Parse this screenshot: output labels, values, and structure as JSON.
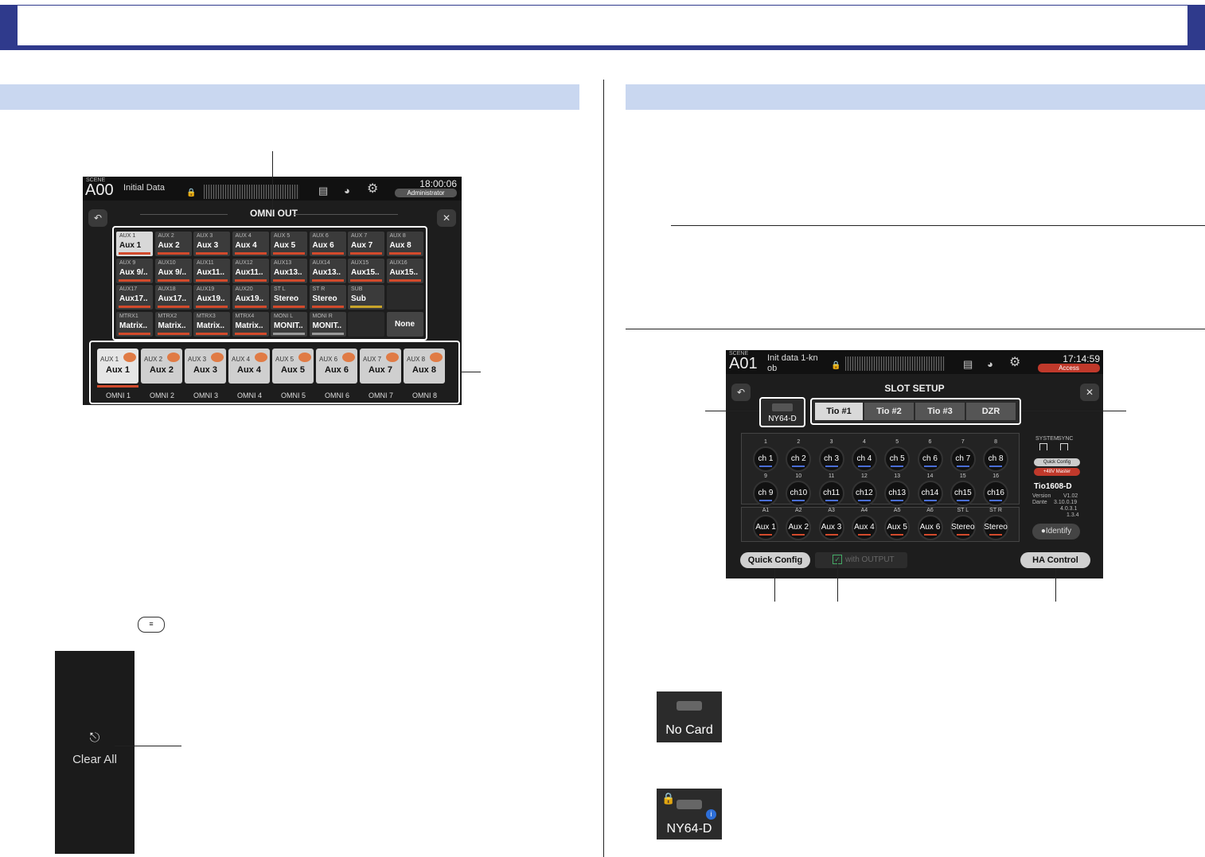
{
  "omni_screen": {
    "scene_label": "SCENE",
    "scene_number": "A00",
    "scene_name": "Initial Data",
    "time": "18:00:06",
    "user": "Administrator",
    "title": "OMNI OUT",
    "grid": [
      {
        "t": "AUX 1",
        "n": "Aux 1"
      },
      {
        "t": "AUX 2",
        "n": "Aux 2"
      },
      {
        "t": "AUX 3",
        "n": "Aux 3"
      },
      {
        "t": "AUX 4",
        "n": "Aux 4"
      },
      {
        "t": "AUX 5",
        "n": "Aux 5"
      },
      {
        "t": "AUX 6",
        "n": "Aux 6"
      },
      {
        "t": "AUX 7",
        "n": "Aux 7"
      },
      {
        "t": "AUX 8",
        "n": "Aux 8"
      },
      {
        "t": "AUX 9",
        "n": "Aux 9/.."
      },
      {
        "t": "AUX10",
        "n": "Aux 9/.."
      },
      {
        "t": "AUX11",
        "n": "Aux11.."
      },
      {
        "t": "AUX12",
        "n": "Aux11.."
      },
      {
        "t": "AUX13",
        "n": "Aux13.."
      },
      {
        "t": "AUX14",
        "n": "Aux13.."
      },
      {
        "t": "AUX15",
        "n": "Aux15.."
      },
      {
        "t": "AUX16",
        "n": "Aux15.."
      },
      {
        "t": "AUX17",
        "n": "Aux17.."
      },
      {
        "t": "AUX18",
        "n": "Aux17.."
      },
      {
        "t": "AUX19",
        "n": "Aux19.."
      },
      {
        "t": "AUX20",
        "n": "Aux19.."
      },
      {
        "t": "ST L",
        "n": "Stereo"
      },
      {
        "t": "ST R",
        "n": "Stereo"
      },
      {
        "t": "SUB",
        "n": "Sub"
      },
      {
        "t": "",
        "n": ""
      },
      {
        "t": "MTRX1",
        "n": "Matrix.."
      },
      {
        "t": "MTRX2",
        "n": "Matrix.."
      },
      {
        "t": "MTRX3",
        "n": "Matrix.."
      },
      {
        "t": "MTRX4",
        "n": "Matrix.."
      },
      {
        "t": "MONI L",
        "n": "MONIT.."
      },
      {
        "t": "MONI R",
        "n": "MONIT.."
      },
      {
        "t": "",
        "n": ""
      },
      {
        "t": "",
        "n": "None"
      }
    ],
    "omni_buttons": [
      {
        "t": "AUX 1",
        "n": "Aux 1",
        "label": "OMNI 1"
      },
      {
        "t": "AUX 2",
        "n": "Aux 2",
        "label": "OMNI 2"
      },
      {
        "t": "AUX 3",
        "n": "Aux 3",
        "label": "OMNI 3"
      },
      {
        "t": "AUX 4",
        "n": "Aux 4",
        "label": "OMNI 4"
      },
      {
        "t": "AUX 5",
        "n": "Aux 5",
        "label": "OMNI 5"
      },
      {
        "t": "AUX 6",
        "n": "Aux 6",
        "label": "OMNI 6"
      },
      {
        "t": "AUX 7",
        "n": "Aux 7",
        "label": "OMNI 7"
      },
      {
        "t": "AUX 8",
        "n": "Aux 8",
        "label": "OMNI 8"
      }
    ]
  },
  "clear_all": {
    "label": "Clear All"
  },
  "slot_screen": {
    "scene_label": "SCENE",
    "scene_number": "A01",
    "scene_name_line1": "Init data 1-kn",
    "scene_name_line2": "ob",
    "time": "17:14:59",
    "access": "Access",
    "title": "SLOT SETUP",
    "card": "NY64-D",
    "tabs": [
      "Tio #1",
      "Tio #2",
      "Tio #3",
      "DZR"
    ],
    "inputs": [
      {
        "t": "1",
        "n": "ch 1"
      },
      {
        "t": "2",
        "n": "ch 2"
      },
      {
        "t": "3",
        "n": "ch 3"
      },
      {
        "t": "4",
        "n": "ch 4"
      },
      {
        "t": "5",
        "n": "ch 5"
      },
      {
        "t": "6",
        "n": "ch 6"
      },
      {
        "t": "7",
        "n": "ch 7"
      },
      {
        "t": "8",
        "n": "ch 8"
      },
      {
        "t": "9",
        "n": "ch 9"
      },
      {
        "t": "10",
        "n": "ch10"
      },
      {
        "t": "11",
        "n": "ch11"
      },
      {
        "t": "12",
        "n": "ch12"
      },
      {
        "t": "13",
        "n": "ch13"
      },
      {
        "t": "14",
        "n": "ch14"
      },
      {
        "t": "15",
        "n": "ch15"
      },
      {
        "t": "16",
        "n": "ch16"
      }
    ],
    "outputs": [
      {
        "t": "A1",
        "n": "Aux 1"
      },
      {
        "t": "A2",
        "n": "Aux 2"
      },
      {
        "t": "A3",
        "n": "Aux 3"
      },
      {
        "t": "A4",
        "n": "Aux 4"
      },
      {
        "t": "A5",
        "n": "Aux 5"
      },
      {
        "t": "A6",
        "n": "Aux 6"
      },
      {
        "t": "ST L",
        "n": "Stereo"
      },
      {
        "t": "ST R",
        "n": "Stereo"
      }
    ],
    "system_label": "SYSTEM",
    "sync_label": "SYNC",
    "quick_config_badge": "Quick Config",
    "phantom_badge": "+48V Master",
    "device_name": "Tio1608-D",
    "version_label": "Version",
    "version_value": "V1.02",
    "dante_label": "Dante",
    "dante_values": [
      "3.10.0.19",
      "4.0.3.1",
      "1.3.4"
    ],
    "identify": "Identify",
    "quick_config_button": "Quick Config",
    "with_output": "with OUTPUT",
    "ha_control": "HA Control"
  },
  "card_icons": [
    {
      "label": "No Card"
    },
    {
      "label": "NY64-D"
    }
  ],
  "colors": {
    "header_blue": "#2f3a8c",
    "section_blue": "#c9d7f0",
    "meter_red": "#d24a2c",
    "meter_blue": "#4a6ed6"
  }
}
